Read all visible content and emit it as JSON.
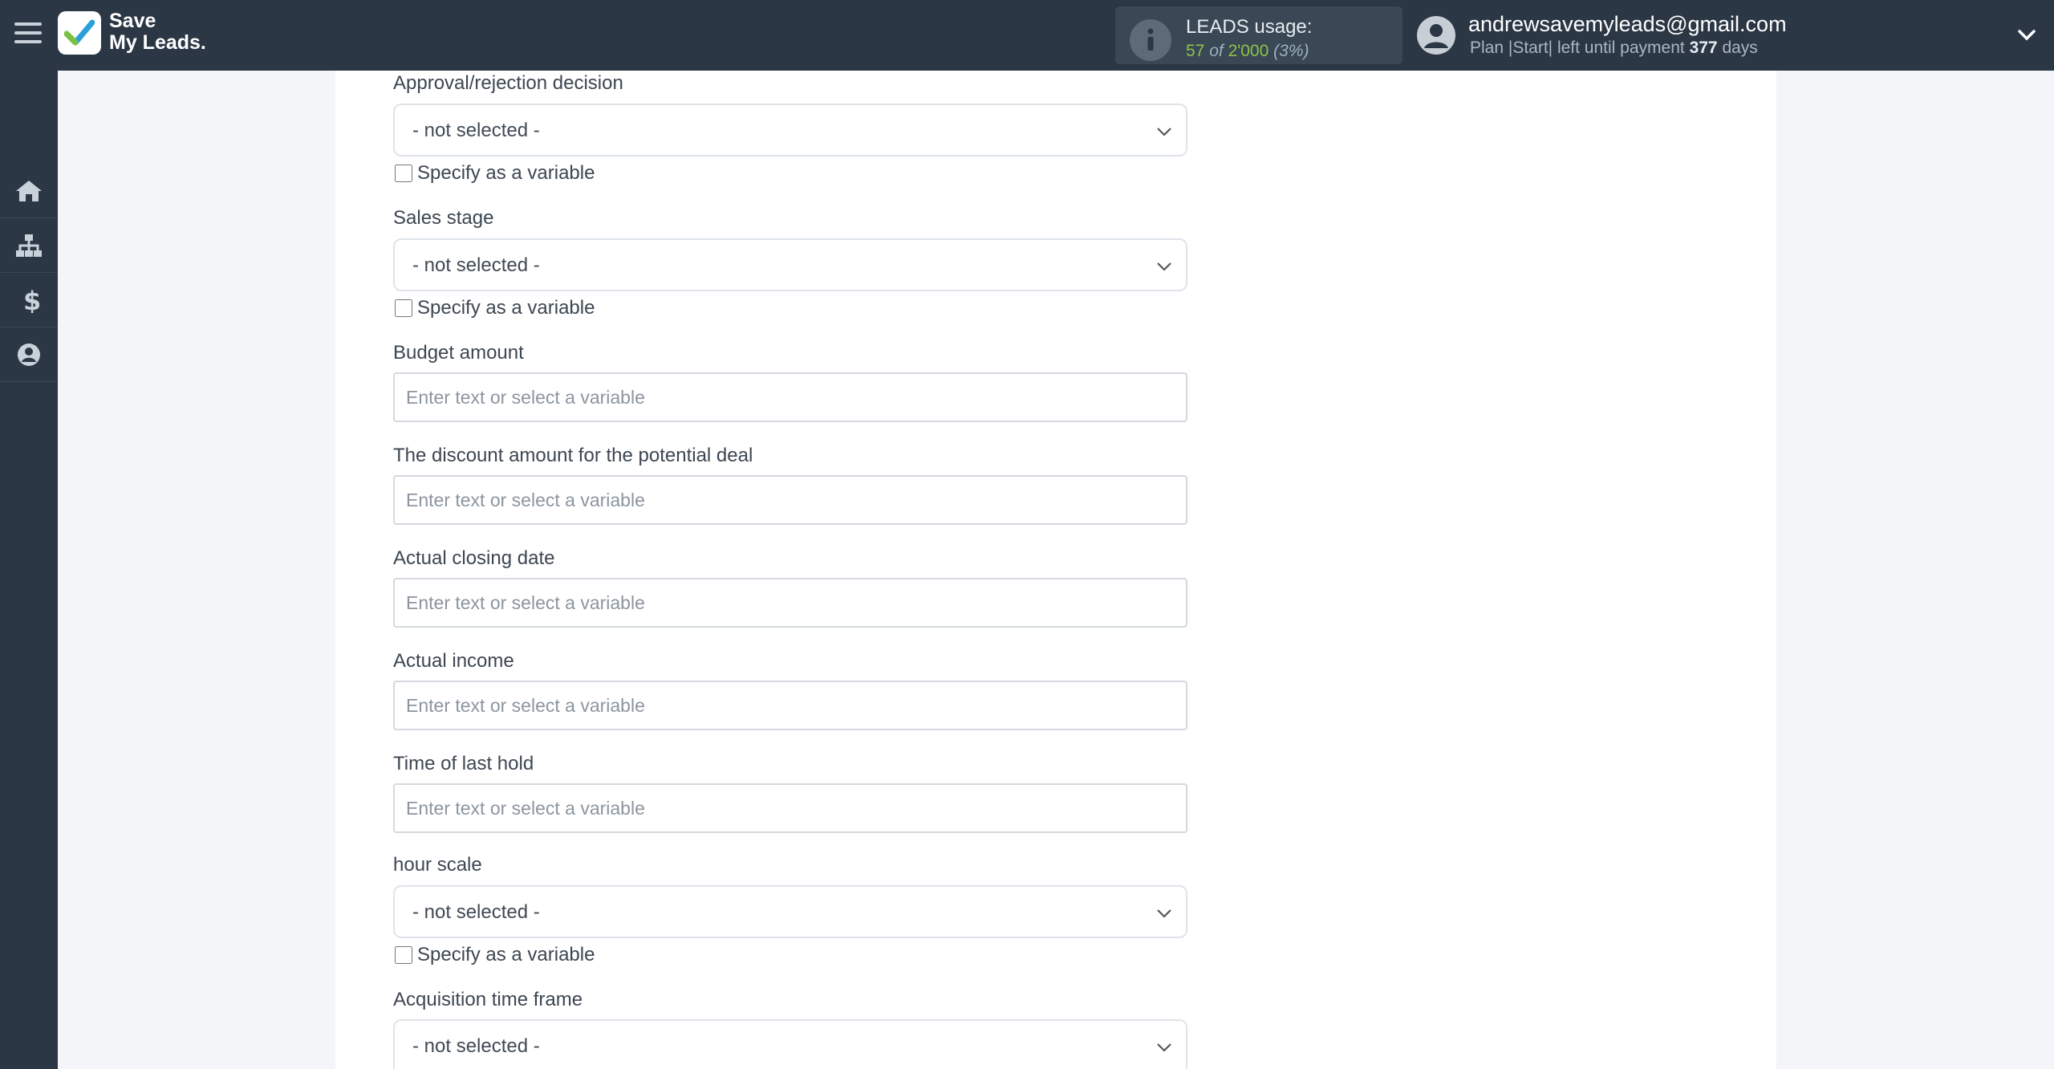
{
  "header": {
    "brand_line1": "Save",
    "brand_line2": "My Leads.",
    "usage_title": "LEADS usage:",
    "usage_used": "57",
    "usage_of": "of",
    "usage_total": "2'000",
    "usage_percent": "(3%)",
    "user_email": "andrewsavemyleads@gmail.com",
    "plan_text": "Plan |Start| left until payment",
    "plan_days": "377",
    "plan_days_unit": "days"
  },
  "sidebar": {
    "items": [
      {
        "icon": "home-icon"
      },
      {
        "icon": "sitemap-icon"
      },
      {
        "icon": "dollar-icon"
      },
      {
        "icon": "account-icon"
      }
    ]
  },
  "form": {
    "approval": {
      "label": "Approval/rejection decision",
      "value": "- not selected -",
      "variable_label": "Specify as a variable"
    },
    "sales_stage": {
      "label": "Sales stage",
      "value": "- not selected -",
      "variable_label": "Specify as a variable"
    },
    "budget": {
      "label": "Budget amount",
      "placeholder": "Enter text or select a variable"
    },
    "discount": {
      "label": "The discount amount for the potential deal",
      "placeholder": "Enter text or select a variable"
    },
    "closing_date": {
      "label": "Actual closing date",
      "placeholder": "Enter text or select a variable"
    },
    "income": {
      "label": "Actual income",
      "placeholder": "Enter text or select a variable"
    },
    "last_hold": {
      "label": "Time of last hold",
      "placeholder": "Enter text or select a variable"
    },
    "hour_scale": {
      "label": "hour scale",
      "value": "- not selected -",
      "variable_label": "Specify as a variable"
    },
    "acquisition": {
      "label": "Acquisition time frame",
      "value": "- not selected -"
    }
  },
  "colors": {
    "accent_green": "#8bc34a",
    "topbar": "#2b3745"
  }
}
